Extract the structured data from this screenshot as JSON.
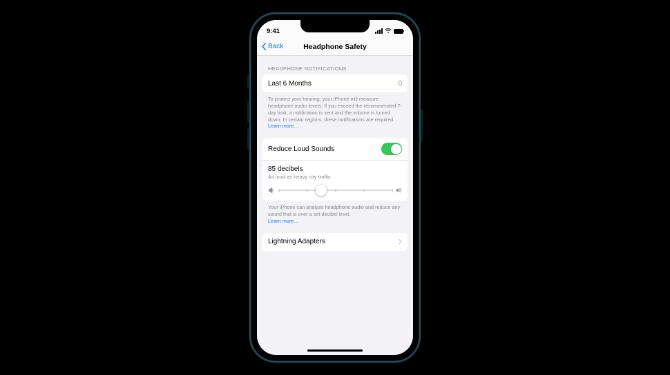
{
  "status": {
    "time": "9:41"
  },
  "nav": {
    "back": "Back",
    "title": "Headphone Safety"
  },
  "notifications": {
    "header": "Headphone Notifications",
    "row_label": "Last 6 Months",
    "row_value": "0",
    "footer": "To protect your hearing, your iPhone will measure headphone audio levels. If you exceed the recommended 7-day limit, a notification is sent and the volume is turned down. In certain regions, these notifications are required.",
    "learn_more": "Learn more…"
  },
  "reduce": {
    "label": "Reduce Loud Sounds",
    "toggle_on": true,
    "decibels": "85 decibels",
    "subtitle": "As loud as heavy city traffic",
    "slider_percent": 38,
    "footer": "Your iPhone can analyze headphone audio and reduce any sound that is over a set decibel level.",
    "learn_more": "Learn more…"
  },
  "adapters": {
    "label": "Lightning Adapters"
  }
}
